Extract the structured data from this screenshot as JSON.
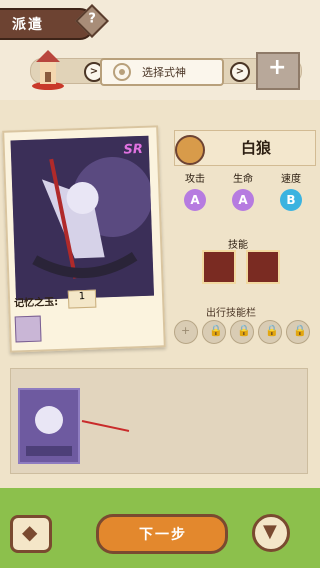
{
  "header": {
    "title": "派遣",
    "help_label": "?",
    "steps": {
      "middle_label": "选择式神",
      "arrow": ">",
      "add_label": "+"
    }
  },
  "character": {
    "rarity": "SR",
    "memory_label": "记忆之玉:",
    "memory_count": "1",
    "name": "白狼",
    "stats": [
      {
        "label": "攻击",
        "grade": "A",
        "color": "#b67be0"
      },
      {
        "label": "生命",
        "grade": "A",
        "color": "#b67be0"
      },
      {
        "label": "速度",
        "grade": "B",
        "color": "#3bb3e0"
      }
    ],
    "skills_label": "技能",
    "skill_slots_label": "出行技能栏"
  },
  "footer": {
    "back_icon": "diamond-arrow-icon",
    "next_label": "下一步",
    "filter_icon": "funnel-icon"
  }
}
